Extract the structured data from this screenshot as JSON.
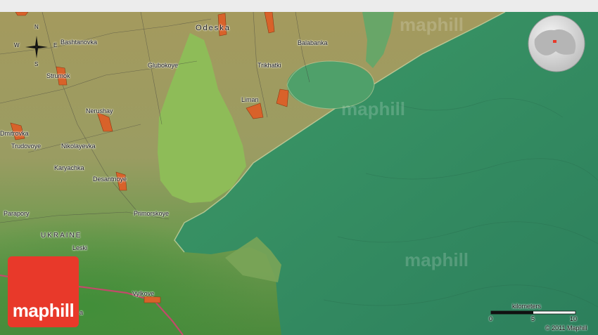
{
  "map": {
    "places": {
      "odeska": "Odeska",
      "bashtanovka": "Bashtanovka",
      "strumok": "Strumok",
      "glubokoye": "Glubokoye",
      "balabanka": "Balabanka",
      "trikhatki": "Trikhatki",
      "liman": "Liman",
      "nerushay": "Nerushay",
      "dmitrovka": "Dmitrovka",
      "trudovoye": "Trudovoye",
      "nikolayevka": "Nikolayevka",
      "karyachka": "Karyachka",
      "desantnoye": "Desantnoye",
      "parapory": "Parapory",
      "primorskoye": "Primorskoye",
      "ukraine": "UKRAINE",
      "leski": "Leski",
      "vylkove": "Vylkove",
      "partial_a": "a"
    },
    "compass": {
      "n": "N",
      "s": "S",
      "e": "E",
      "w": "W"
    },
    "scale": {
      "title": "kilometers",
      "ticks": [
        "0",
        "5",
        "10"
      ]
    },
    "copyright": "© 2011 Maphill",
    "logo_text": "maphill",
    "watermark_text": "maphill",
    "colors": {
      "sea": "#2f8a5f",
      "land": "#8fa25e",
      "lake": "#88b85a",
      "settlement": "#d8622a",
      "logo": "#e8392a"
    }
  }
}
